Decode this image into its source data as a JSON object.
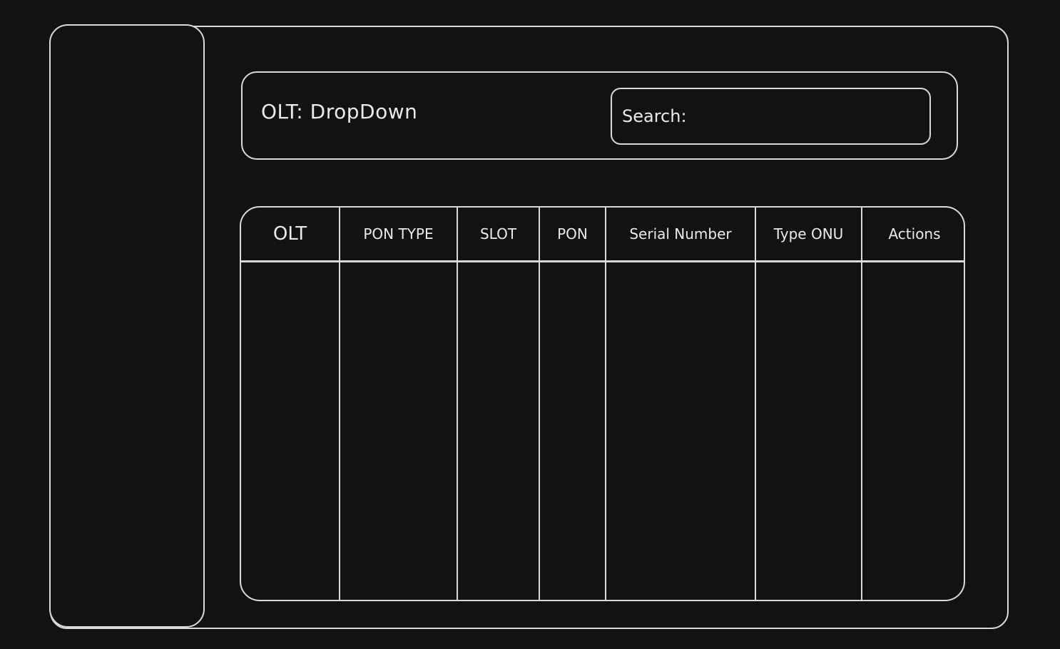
{
  "header": {
    "olt_label": "OLT: DropDown",
    "search_label": "Search:",
    "search_value": ""
  },
  "table": {
    "columns": [
      "OLT",
      "PON TYPE",
      "SLOT",
      "PON",
      "Serial Number",
      "Type ONU",
      "Actions"
    ],
    "rows": []
  },
  "colors": {
    "background": "#121212",
    "stroke": "#d9d9d9",
    "text": "#eaeaea"
  }
}
